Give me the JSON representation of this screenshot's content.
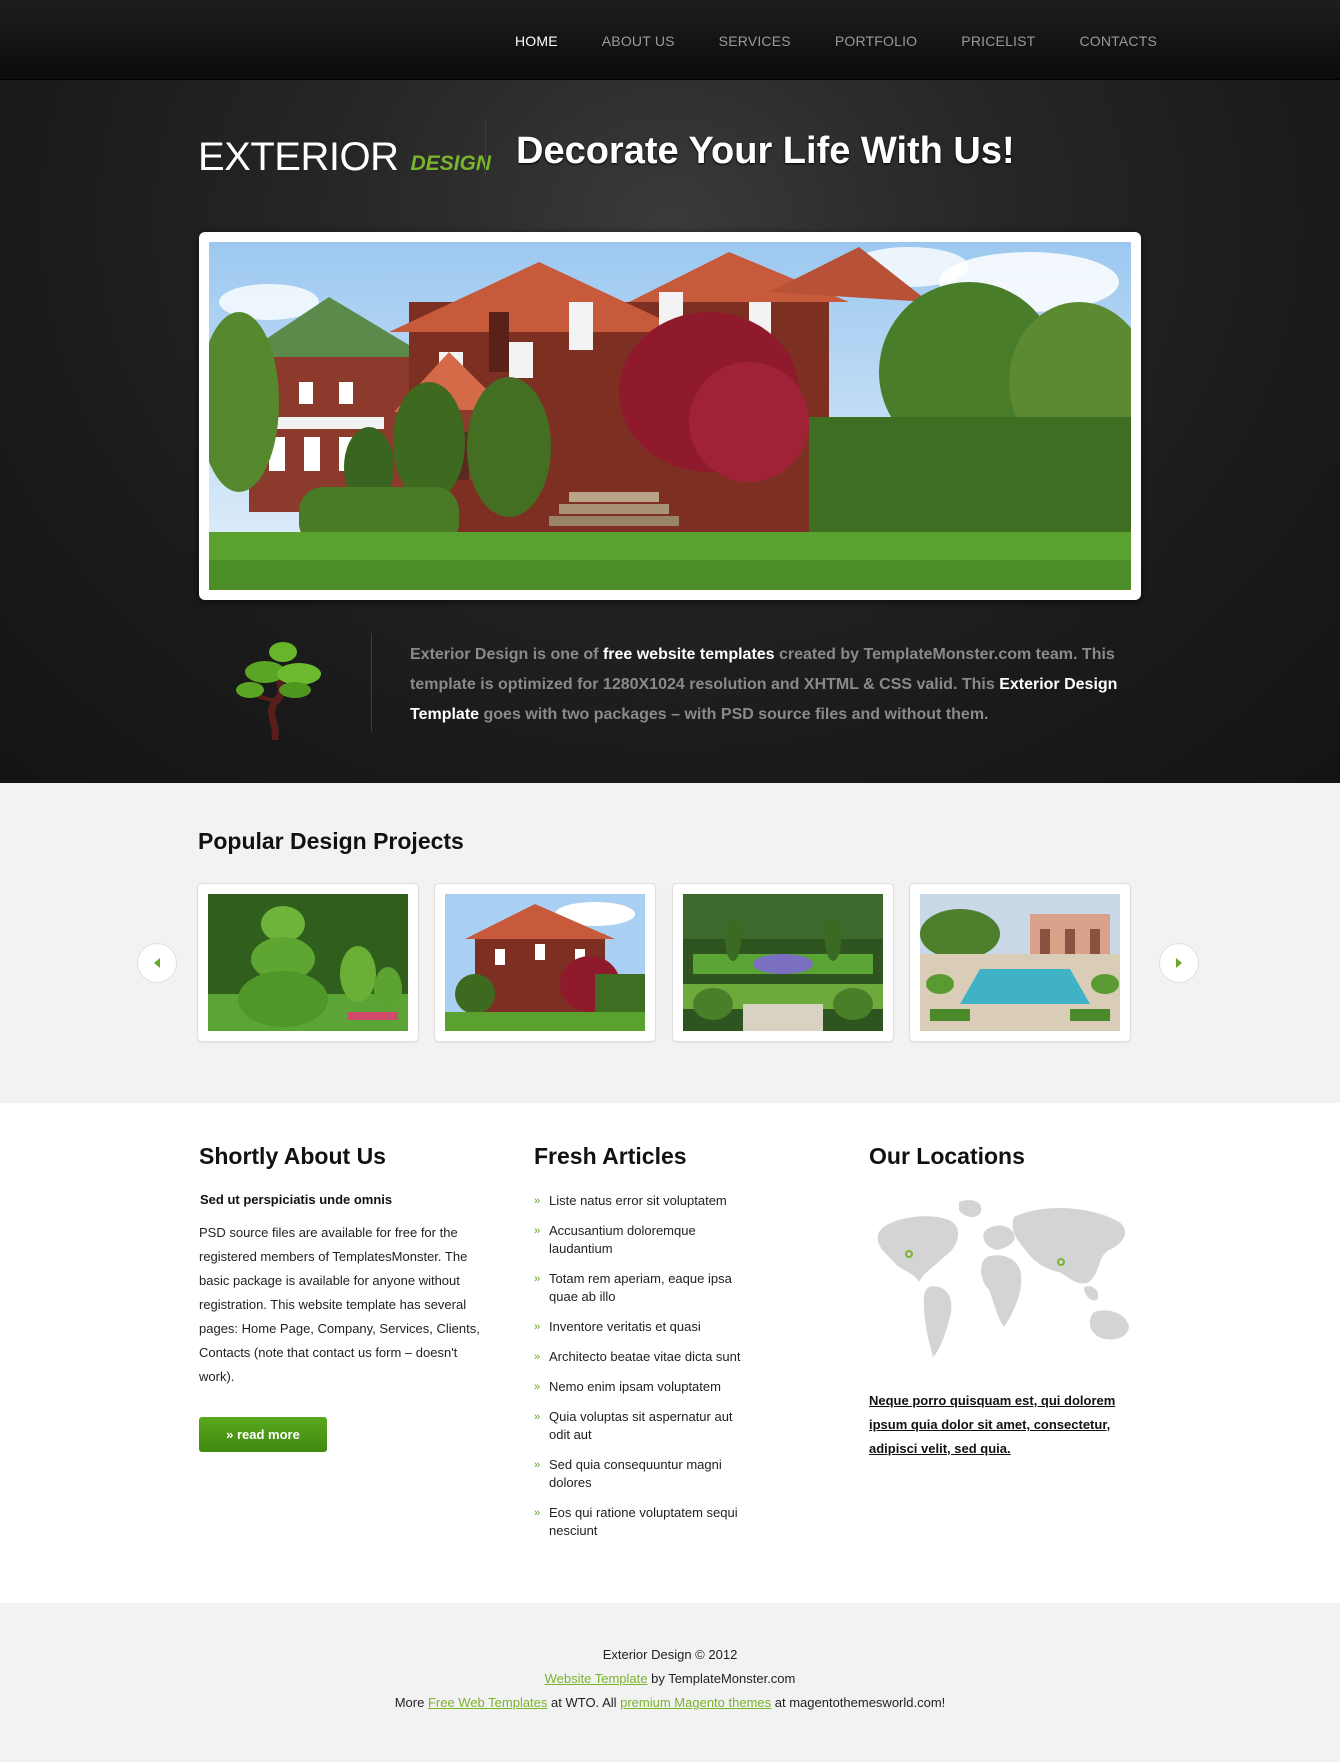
{
  "nav": {
    "items": [
      "HOME",
      "ABOUT US",
      "SERVICES",
      "PORTFOLIO",
      "PRICELIST",
      "CONTACTS"
    ]
  },
  "header": {
    "logo_main": "EXTERIOR",
    "logo_sub": "DESIGN",
    "tagline": "Decorate Your Life With Us!"
  },
  "intro": {
    "t1": "Exterior Design is one of ",
    "b1": "free website templates",
    "t2": " created by TemplateMonster.com team. This template is optimized for 1280X1024 resolution and XHTML & CSS valid. This ",
    "b2": "Exterior Design Template",
    "t3": " goes with two packages – with PSD source files and without them."
  },
  "popular": {
    "title": "Popular Design Projects",
    "thumbs": [
      "topiary-garden",
      "brick-house",
      "formal-garden",
      "villa-pool"
    ]
  },
  "about": {
    "title": "Shortly About Us",
    "subtitle": "Sed ut perspiciatis unde omnis",
    "text": "PSD source files are available for free for the registered members of TemplatesMonster. The basic package is available for anyone without registration. This website template has several pages: Home Page, Company, Services, Clients, Contacts (note that contact us form – doesn't work).",
    "button": "read more",
    "button_prefix": "»"
  },
  "articles": {
    "title": "Fresh Articles",
    "bullet": "»",
    "items": [
      "Liste natus error sit voluptatem",
      "Accusantium doloremque laudantium",
      "Totam rem aperiam, eaque ipsa quae ab illo",
      "Inventore veritatis et quasi",
      "Architecto beatae vitae dicta sunt",
      "Nemo enim ipsam voluptatem",
      "Quia voluptas sit aspernatur aut odit aut",
      "Sed quia consequuntur magni dolores",
      "Eos qui ratione voluptatem sequi nesciunt"
    ]
  },
  "locations": {
    "title": "Our Locations",
    "link": "Neque porro quisquam est, qui dolorem ipsum quia dolor sit amet, consectetur, adipisci velit, sed quia."
  },
  "footer": {
    "line1": "Exterior Design © 2012",
    "l2_link": "Website Template",
    "l2_text": " by TemplateMonster.com",
    "l3_a": "More ",
    "l3_link1": "Free Web Templates",
    "l3_b": " at WTO. All ",
    "l3_link2": "premium Magento themes",
    "l3_c": " at magentothemesworld.com!"
  },
  "colors": {
    "accent": "#7ab32e",
    "button": "#4c9a16",
    "dark_bg": "#1c1c1c",
    "light_bg": "#f2f2f2"
  }
}
